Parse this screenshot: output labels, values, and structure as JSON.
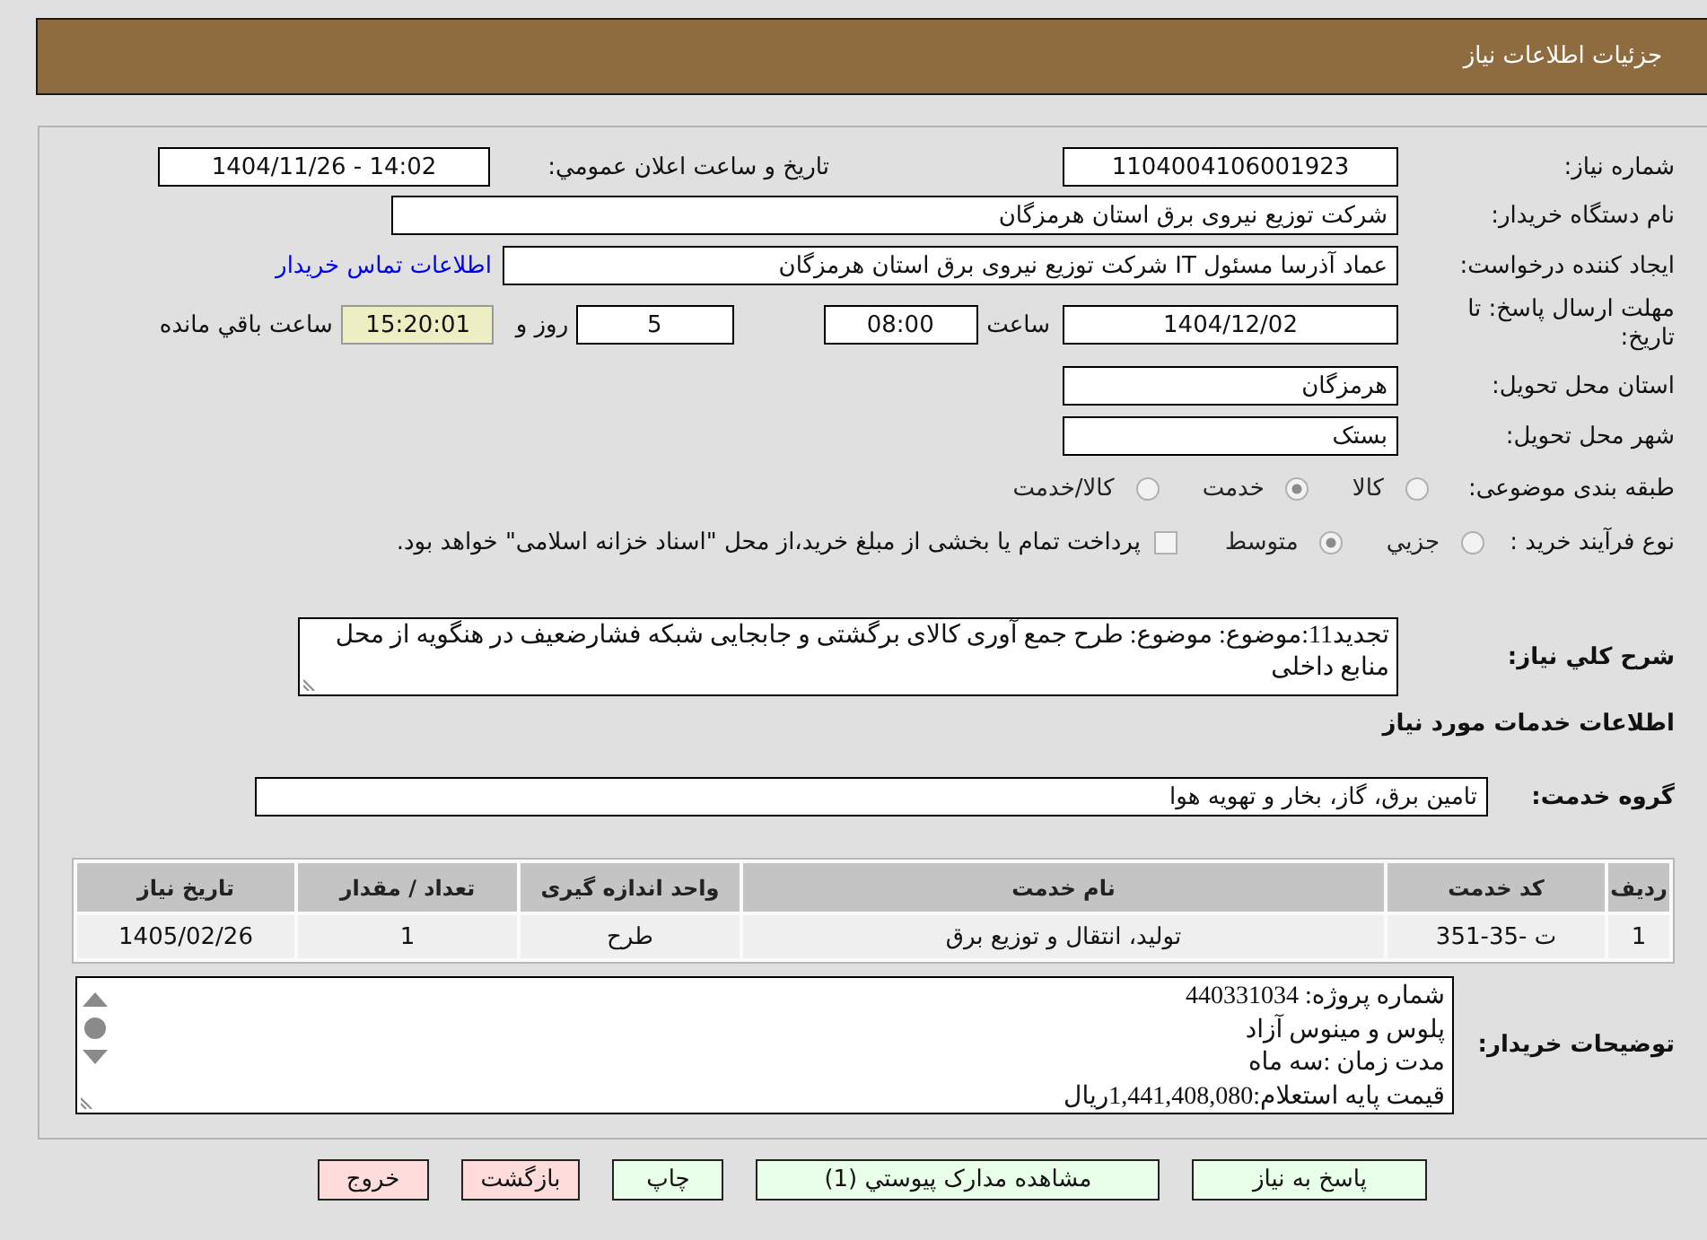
{
  "header": {
    "title": "جزئیات اطلاعات نیاز"
  },
  "need_number": {
    "label": "شماره نیاز:",
    "value": "1104004106001923"
  },
  "announce": {
    "label": "تاریخ و ساعت اعلان عمومي:",
    "value": "1404/11/26 - 14:02"
  },
  "buyer_org": {
    "label": "نام دستگاه خریدار:",
    "value": "شرکت توزیع نیروی برق استان هرمزگان"
  },
  "requester": {
    "label": "ایجاد کننده درخواست:",
    "value": "عماد آذرسا مسئول IT شرکت توزیع نیروی برق استان هرمزگان",
    "link": "اطلاعات تماس خریدار"
  },
  "deadline": {
    "label": "مهلت ارسال پاسخ: تا تاریخ:",
    "date": "1404/12/02",
    "time_label": "ساعت",
    "time": "08:00",
    "days": "5",
    "days_label": "روز و",
    "remaining": "15:20:01",
    "remaining_label": "ساعت باقي مانده"
  },
  "province": {
    "label": "استان محل تحویل:",
    "value": "هرمزگان"
  },
  "city": {
    "label": "شهر محل تحویل:",
    "value": "بستک"
  },
  "category": {
    "label": "طبقه بندی موضوعی:",
    "options": [
      {
        "label": "کالا",
        "selected": false
      },
      {
        "label": "خدمت",
        "selected": true
      },
      {
        "label": "کالا/خدمت",
        "selected": false
      }
    ]
  },
  "purchase_process": {
    "label": "نوع فرآیند خرید :",
    "options": [
      {
        "label": "جزيي",
        "selected": false
      },
      {
        "label": "متوسط",
        "selected": true
      }
    ],
    "treasury": {
      "text": "پرداخت تمام یا بخشی از مبلغ خرید،از محل \"اسناد خزانه اسلامی\" خواهد بود.",
      "checked": false
    }
  },
  "description": {
    "label": "شرح کلي نیاز:",
    "value": "تجدید11:موضوع: موضوع: طرح جمع آوری کالای برگشتی و جابجایی شبکه فشارضعیف در هنگویه از محل منابع داخلی"
  },
  "services": {
    "heading": "اطلاعات خدمات مورد نیاز",
    "group_label": "گروه خدمت:",
    "group": "تامین برق، گاز، بخار و تهویه هوا",
    "table": {
      "columns": [
        "ردیف",
        "کد خدمت",
        "نام خدمت",
        "واحد اندازه گیری",
        "تعداد / مقدار",
        "تاریخ نیاز"
      ],
      "rows": [
        [
          "1",
          "ت -35-351",
          "تولید، انتقال و توزیع برق",
          "طرح",
          "1",
          "1405/02/26"
        ]
      ]
    }
  },
  "buyer_notes": {
    "label": "توضیحات خریدار:",
    "lines": [
      "شماره پروژه: 440331034",
      "پلوس و مینوس آزاد",
      "مدت زمان :سه ماه",
      "قیمت پایه استعلام:1,441,408,080ریال"
    ]
  },
  "buttons": [
    {
      "label": "پاسخ به نیاز",
      "kind": "confirm"
    },
    {
      "label": "مشاهده مدارک پیوستي (1)",
      "kind": "confirm"
    },
    {
      "label": "چاپ",
      "kind": "confirm"
    },
    {
      "label": "بازگشت",
      "kind": "cancel"
    },
    {
      "label": "خروج",
      "kind": "cancel"
    }
  ]
}
